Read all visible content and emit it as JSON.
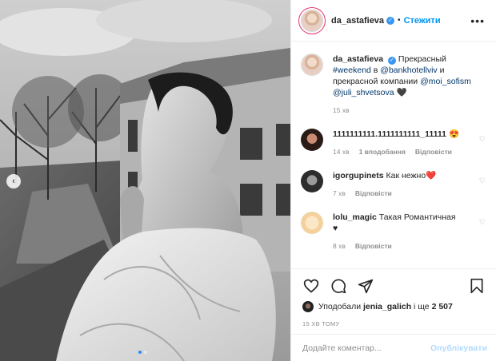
{
  "post": {
    "image_alt": "Black and white photo: woman wrapped in a blanket on a balcony overlooking a city street",
    "carousel_index": 1,
    "carousel_count": 2
  },
  "header": {
    "username": "da_astafieva",
    "separator": "•",
    "follow_label": "Стежити",
    "more_icon": "more-horizontal-icon"
  },
  "caption": {
    "username": "da_astafieva",
    "text_1": "Прекрасный",
    "hashtag": "#weekend",
    "text_2": "в",
    "mention_1": "@bankhotellviv",
    "text_3": "и прекрасной компании",
    "mention_2": "@moi_sofism",
    "mention_3": "@juli_shvetsova",
    "emoji": "🖤",
    "time": "15 хв"
  },
  "comments": [
    {
      "username": "1111111111.1111111111_11111",
      "text": "",
      "emoji": "😍",
      "time": "14 хв",
      "likes": "1 вподобання",
      "reply": "Відповісти"
    },
    {
      "username": "igorgupinets",
      "text": "Как нежно",
      "emoji": "❤️",
      "time": "7 хв",
      "reply": "Відповісти"
    },
    {
      "username": "lolu_magic",
      "text": "Такая Романтичная",
      "emoji": "♥",
      "time": "8 хв",
      "reply": "Відповісти"
    }
  ],
  "actions": {
    "like_icon": "heart-icon",
    "comment_icon": "comment-icon",
    "share_icon": "share-icon",
    "save_icon": "bookmark-icon"
  },
  "likes": {
    "prefix": "Уподобали",
    "user": "jenia_galich",
    "suffix": "і ще",
    "count": "2 507"
  },
  "timestamp": "15 ХВ ТОМУ",
  "add_comment": {
    "placeholder": "Додайте коментар...",
    "post_label": "Опублікувати"
  }
}
